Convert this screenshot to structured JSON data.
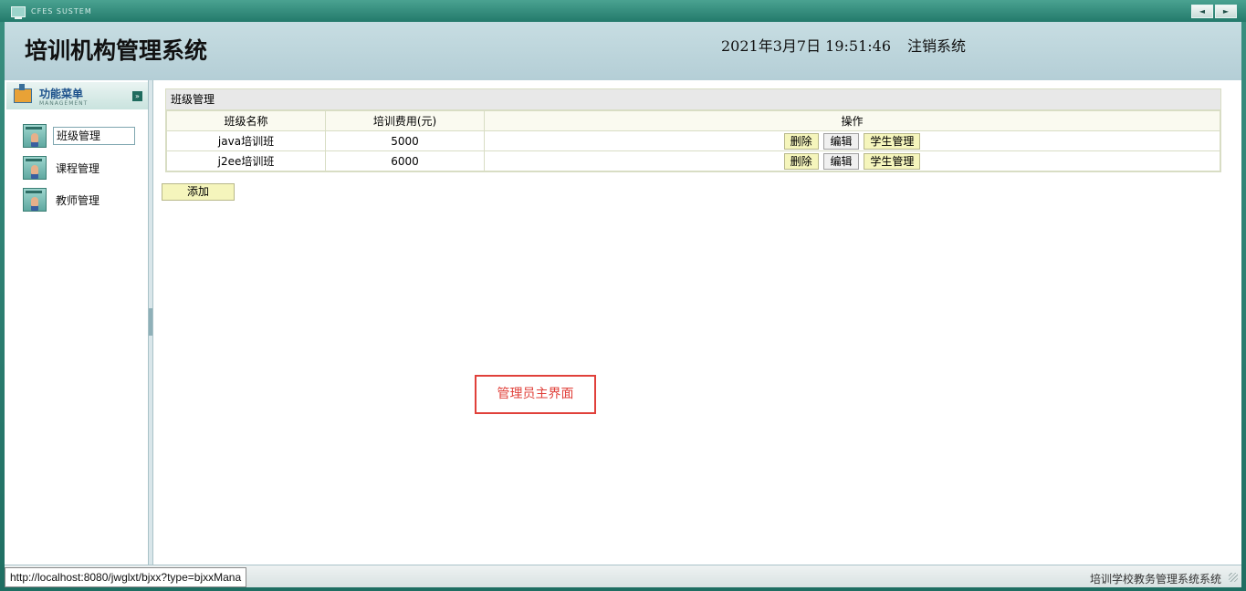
{
  "titlebar": {
    "system_label": "CFES SUSTEM",
    "prev_symbol": "◄",
    "next_symbol": "►"
  },
  "header": {
    "app_title": "培训机构管理系统",
    "datetime": "2021年3月7日 19:51:46",
    "logout_label": "注销系统"
  },
  "sidebar": {
    "menu_title": "功能菜单",
    "menu_subtitle": "MANAGEMENT",
    "collapse_symbol": "»",
    "items": [
      {
        "label": "班级管理",
        "icon": "user-card-icon",
        "active": true
      },
      {
        "label": "课程管理",
        "icon": "user-card-icon",
        "active": false
      },
      {
        "label": "教师管理",
        "icon": "user-card-icon",
        "active": false
      }
    ]
  },
  "main": {
    "panel_title": "班级管理",
    "columns": [
      "班级名称",
      "培训费用(元)",
      "操作"
    ],
    "rows": [
      {
        "name": "java培训班",
        "fee": "5000",
        "actions": [
          "删除",
          "编辑",
          "学生管理"
        ]
      },
      {
        "name": "j2ee培训班",
        "fee": "6000",
        "actions": [
          "删除",
          "编辑",
          "学生管理"
        ]
      }
    ],
    "add_label": "添加",
    "annotation": "管理员主界面"
  },
  "statusbar": {
    "right_text": "培训学校教务管理系统系统",
    "url_tooltip": "http://localhost:8080/jwglxt/bjxx?type=bjxxMana"
  },
  "colors": {
    "frame": "#2a7a6e",
    "header_bg": "#c7dde2",
    "button_yellow": "#f5f5bc",
    "annotation_red": "#e0403a"
  }
}
